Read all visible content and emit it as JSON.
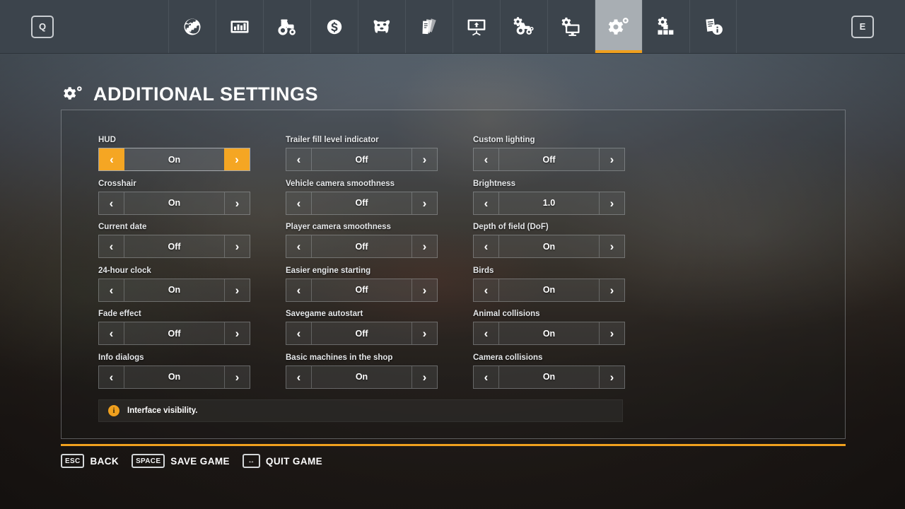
{
  "topbar": {
    "left_key": "Q",
    "right_key": "E",
    "tabs": [
      {
        "icon": "globe-icon",
        "name": "general",
        "active": false
      },
      {
        "icon": "bar-chart-icon",
        "name": "statistics",
        "active": false
      },
      {
        "icon": "tractor-icon",
        "name": "vehicles",
        "active": false
      },
      {
        "icon": "money-icon",
        "name": "finances",
        "active": false
      },
      {
        "icon": "cow-icon",
        "name": "animals",
        "active": false
      },
      {
        "icon": "contracts-icon",
        "name": "contracts",
        "active": false
      },
      {
        "icon": "presentation-icon",
        "name": "tutorials",
        "active": false
      },
      {
        "icon": "vehicle-settings-icon",
        "name": "game-settings",
        "active": false
      },
      {
        "icon": "display-settings-icon",
        "name": "display",
        "active": false
      },
      {
        "icon": "gear-settings-icon",
        "name": "additional-settings",
        "active": true
      },
      {
        "icon": "mods-icon",
        "name": "mods",
        "active": false
      },
      {
        "icon": "help-icon",
        "name": "help",
        "active": false
      }
    ]
  },
  "header": {
    "icon": "gear-settings-icon",
    "title": "ADDITIONAL SETTINGS"
  },
  "settings": {
    "columns": [
      [
        {
          "label": "HUD",
          "value": "On",
          "selected": true
        },
        {
          "label": "Crosshair",
          "value": "On",
          "selected": false
        },
        {
          "label": "Current date",
          "value": "Off",
          "selected": false
        },
        {
          "label": "24-hour clock",
          "value": "On",
          "selected": false
        },
        {
          "label": "Fade effect",
          "value": "Off",
          "selected": false
        },
        {
          "label": "Info dialogs",
          "value": "On",
          "selected": false
        }
      ],
      [
        {
          "label": "Trailer fill level indicator",
          "value": "Off",
          "selected": false
        },
        {
          "label": "Vehicle camera smoothness",
          "value": "Off",
          "selected": false
        },
        {
          "label": "Player camera smoothness",
          "value": "Off",
          "selected": false
        },
        {
          "label": "Easier engine starting",
          "value": "Off",
          "selected": false
        },
        {
          "label": "Savegame autostart",
          "value": "Off",
          "selected": false
        },
        {
          "label": "Basic machines in the shop",
          "value": "On",
          "selected": false
        }
      ],
      [
        {
          "label": "Custom lighting",
          "value": "Off",
          "selected": false
        },
        {
          "label": "Brightness",
          "value": "1.0",
          "selected": false
        },
        {
          "label": "Depth of field (DoF)",
          "value": "On",
          "selected": false
        },
        {
          "label": "Birds",
          "value": "On",
          "selected": false
        },
        {
          "label": "Animal collisions",
          "value": "On",
          "selected": false
        },
        {
          "label": "Camera collisions",
          "value": "On",
          "selected": false
        }
      ]
    ],
    "arrow_left": "‹",
    "arrow_right": "›"
  },
  "info": {
    "icon": "info-icon",
    "glyph": "i",
    "text": "Interface visibility."
  },
  "footer": {
    "hints": [
      {
        "key": "ESC",
        "label": "BACK"
      },
      {
        "key": "SPACE",
        "label": "SAVE GAME"
      },
      {
        "key": "↔",
        "label": "QUIT GAME"
      }
    ]
  },
  "colors": {
    "accent": "#f0a01e",
    "selected": "#f5a623",
    "topbar": "#3c444c",
    "tab_active": "#a8aeb3"
  }
}
